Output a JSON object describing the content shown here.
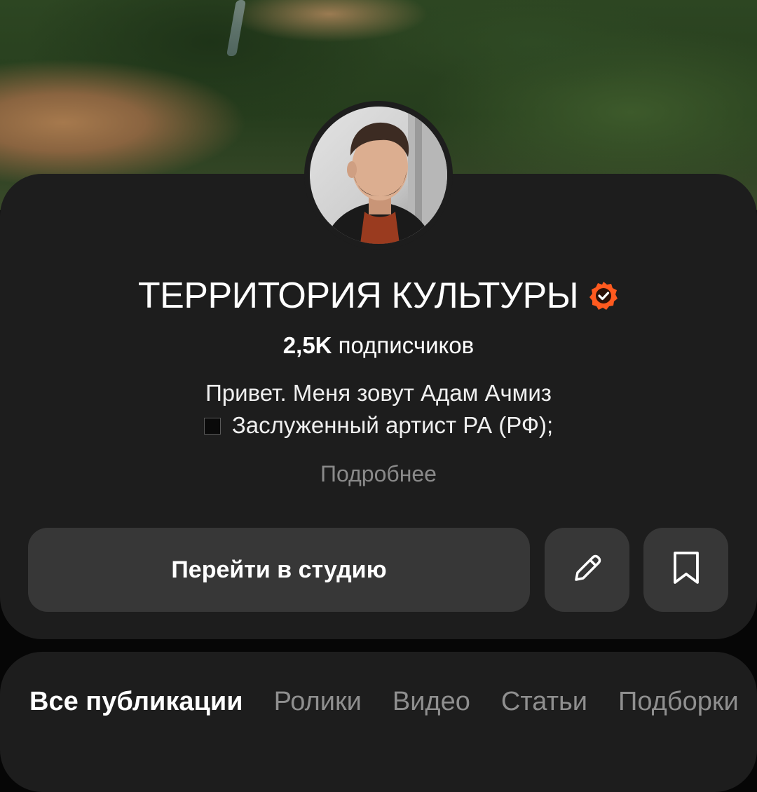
{
  "cover": {
    "image": "forest-landscape-cover"
  },
  "avatar": {
    "image": "profile-photo"
  },
  "channel": {
    "title": "ТЕРРИТОРИЯ КУЛЬТУРЫ",
    "verified_icon": "verified-badge-icon",
    "subscribers_count": "2,5K",
    "subscribers_label": " подписчиков",
    "description_line1": "Привет. Меня зовут Адам Ачмиз",
    "description_line2": "Заслуженный артист РА (РФ);",
    "more_link": "Подробнее"
  },
  "actions": {
    "studio_button": "Перейти в студию",
    "edit_icon": "pencil-icon",
    "bookmark_icon": "bookmark-icon"
  },
  "tabs": [
    {
      "label": "Все публикации",
      "active": true
    },
    {
      "label": "Ролики",
      "active": false
    },
    {
      "label": "Видео",
      "active": false
    },
    {
      "label": "Статьи",
      "active": false
    },
    {
      "label": "Подборки",
      "active": false
    }
  ],
  "colors": {
    "background": "#060606",
    "card": "#1d1d1d",
    "button": "#373737",
    "accent_verified": "#ff5a1f",
    "muted_text": "#8a8a8a"
  }
}
